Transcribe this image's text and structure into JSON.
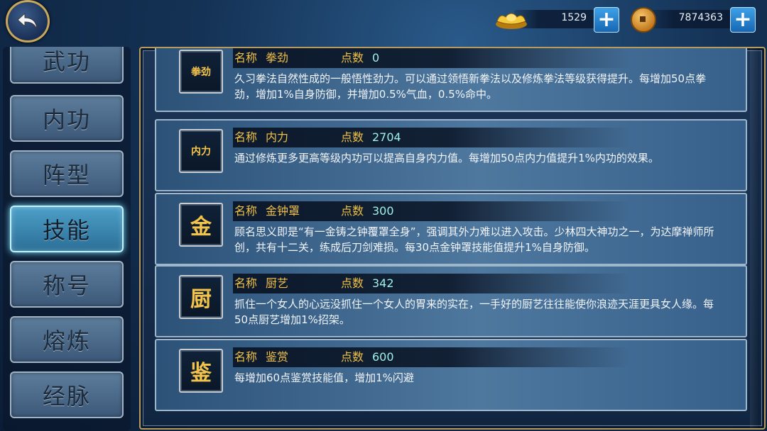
{
  "topbar": {
    "gold_value": "1529",
    "copper_value": "7874363",
    "plus_label": "+"
  },
  "sidebar": {
    "items": [
      {
        "label": "武功",
        "active": false
      },
      {
        "label": "内功",
        "active": false
      },
      {
        "label": "阵型",
        "active": false
      },
      {
        "label": "技能",
        "active": true
      },
      {
        "label": "称号",
        "active": false
      },
      {
        "label": "熔炼",
        "active": false
      },
      {
        "label": "经脉",
        "active": false
      }
    ]
  },
  "skills": {
    "name_label": "名称",
    "points_label": "点数",
    "items": [
      {
        "icon": "拳劲",
        "name": "拳劲",
        "points": "0",
        "desc": "久习拳法自然性成的一般悟性劲力。可以通过领悟新拳法以及修炼拳法等级获得提升。每增加50点拳劲，增加1%自身防御，并增加0.5%气血，0.5%命中。"
      },
      {
        "icon": "内力",
        "name": "内力",
        "points": "2704",
        "desc": "通过修炼更多更高等级内功可以提高自身内力值。每增加50点内力值提升1%内功的效果。"
      },
      {
        "icon": "金",
        "name": "金钟罩",
        "points": "300",
        "desc": "顾名思义即是“有一金铸之钟覆罩全身”，强调其外力难以进入攻击。少林四大神功之一，为达摩禅师所创，共有十二关，练成后刀剑难损。每30点金钟罩技能值提升1%自身防御。"
      },
      {
        "icon": "厨",
        "name": "厨艺",
        "points": "342",
        "desc": "抓住一个女人的心远没抓住一个女人的胃来的实在，一手好的厨艺往往能使你浪迹天涯更具女人缘。每50点厨艺增加1%招架。"
      },
      {
        "icon": "鉴",
        "name": "鉴赏",
        "points": "600",
        "desc": "每增加60点鉴赏技能值，增加1%闪避"
      }
    ]
  }
}
